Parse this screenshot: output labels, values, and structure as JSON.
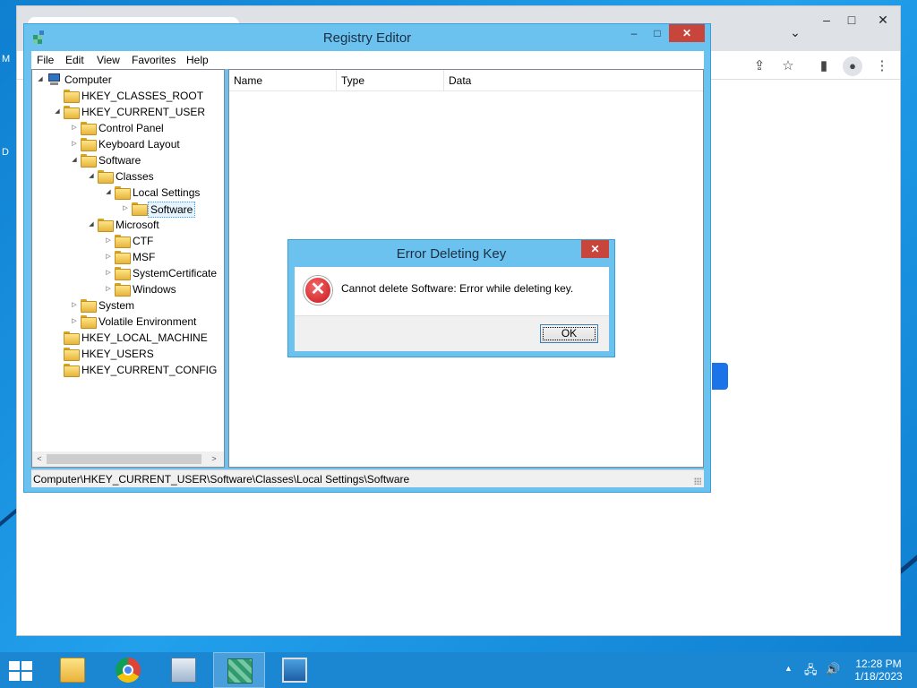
{
  "desktop": {
    "edge_letters": [
      "M",
      "D"
    ]
  },
  "browser": {
    "caption": {
      "minimize": "–",
      "maximize": "□",
      "close": "✕",
      "tab_menu": "⌄"
    },
    "toolbar": {
      "share_icon": "share-icon",
      "bookmark_icon": "star-icon",
      "sidebar_icon": "sidebar-icon",
      "profile_icon": "profile-icon",
      "menu_icon": "kebab-menu-icon"
    }
  },
  "regedit": {
    "title": "Registry Editor",
    "caption": {
      "minimize": "–",
      "maximize": "□",
      "close": "✕"
    },
    "menu": [
      "File",
      "Edit",
      "View",
      "Favorites",
      "Help"
    ],
    "tree": [
      {
        "label": "Computer",
        "level": 0,
        "toggle": "◢",
        "icon": "computer"
      },
      {
        "label": "HKEY_CLASSES_ROOT",
        "level": 1,
        "toggle": "",
        "icon": "folder"
      },
      {
        "label": "HKEY_CURRENT_USER",
        "level": 1,
        "toggle": "◢",
        "icon": "folder"
      },
      {
        "label": "Control Panel",
        "level": 2,
        "toggle": "▷",
        "icon": "folder"
      },
      {
        "label": "Keyboard Layout",
        "level": 2,
        "toggle": "▷",
        "icon": "folder"
      },
      {
        "label": "Software",
        "level": 2,
        "toggle": "◢",
        "icon": "folder"
      },
      {
        "label": "Classes",
        "level": 3,
        "toggle": "◢",
        "icon": "folder"
      },
      {
        "label": "Local Settings",
        "level": 4,
        "toggle": "◢",
        "icon": "folder"
      },
      {
        "label": "Software",
        "level": 5,
        "toggle": "▷",
        "icon": "folder",
        "selected": true
      },
      {
        "label": "Microsoft",
        "level": 3,
        "toggle": "◢",
        "icon": "folder"
      },
      {
        "label": "CTF",
        "level": 4,
        "toggle": "▷",
        "icon": "folder"
      },
      {
        "label": "MSF",
        "level": 4,
        "toggle": "▷",
        "icon": "folder"
      },
      {
        "label": "SystemCertificate",
        "level": 4,
        "toggle": "▷",
        "icon": "folder"
      },
      {
        "label": "Windows",
        "level": 4,
        "toggle": "▷",
        "icon": "folder"
      },
      {
        "label": "System",
        "level": 2,
        "toggle": "▷",
        "icon": "folder"
      },
      {
        "label": "Volatile Environment",
        "level": 2,
        "toggle": "▷",
        "icon": "folder"
      },
      {
        "label": "HKEY_LOCAL_MACHINE",
        "level": 1,
        "toggle": "",
        "icon": "folder"
      },
      {
        "label": "HKEY_USERS",
        "level": 1,
        "toggle": "",
        "icon": "folder"
      },
      {
        "label": "HKEY_CURRENT_CONFIG",
        "level": 1,
        "toggle": "",
        "icon": "folder"
      }
    ],
    "scroll": {
      "left": "<",
      "right": ">"
    },
    "columns": [
      "Name",
      "Type",
      "Data"
    ],
    "status": "Computer\\HKEY_CURRENT_USER\\Software\\Classes\\Local Settings\\Software"
  },
  "dialog": {
    "title": "Error Deleting Key",
    "close": "✕",
    "icon_glyph": "✕",
    "message": "Cannot delete Software:  Error while deleting key.",
    "ok_label": "OK"
  },
  "taskbar": {
    "apps": [
      {
        "name": "file-explorer-icon",
        "active": false
      },
      {
        "name": "chrome-icon",
        "active": false
      },
      {
        "name": "server-manager-icon",
        "active": false
      },
      {
        "name": "registry-editor-icon",
        "active": true
      },
      {
        "name": "remote-desktop-icon",
        "active": false
      }
    ],
    "tray": {
      "chevron": "▲",
      "network": "🖧",
      "volume": "🔊"
    },
    "time": "12:28 PM",
    "date": "1/18/2023"
  }
}
